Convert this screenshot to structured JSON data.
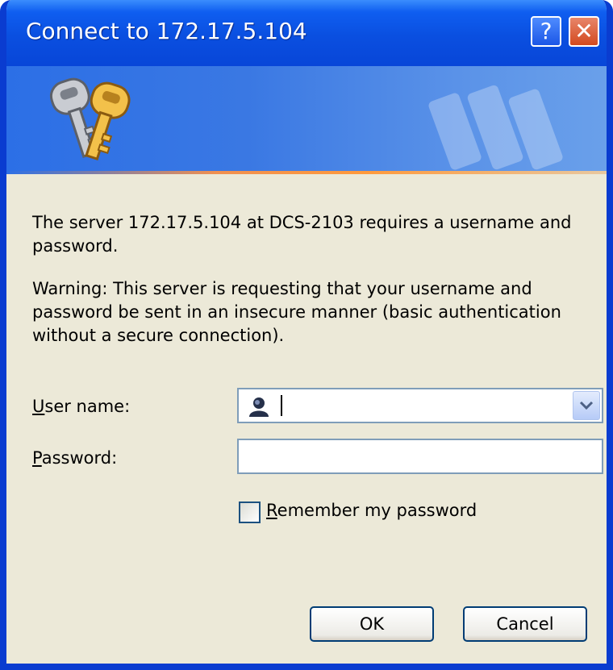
{
  "window": {
    "title": "Connect to 172.17.5.104",
    "help_glyph": "?",
    "close_glyph": "✕",
    "accent_color": "#0a4fe0"
  },
  "banner": {
    "icon": "keys-icon"
  },
  "message": {
    "line1": "The server 172.17.5.104 at DCS-2103 requires a username and password.",
    "warning": "Warning: This server is requesting that your username and password be sent in an insecure manner (basic authentication without a secure connection)."
  },
  "form": {
    "username": {
      "label_ul": "U",
      "label_rest": "ser name:",
      "value": ""
    },
    "password": {
      "label_ul": "P",
      "label_rest": "assword:",
      "value": ""
    },
    "remember": {
      "label_ul": "R",
      "label_rest": "emember my password",
      "checked": false
    }
  },
  "buttons": {
    "ok": "OK",
    "cancel": "Cancel"
  }
}
